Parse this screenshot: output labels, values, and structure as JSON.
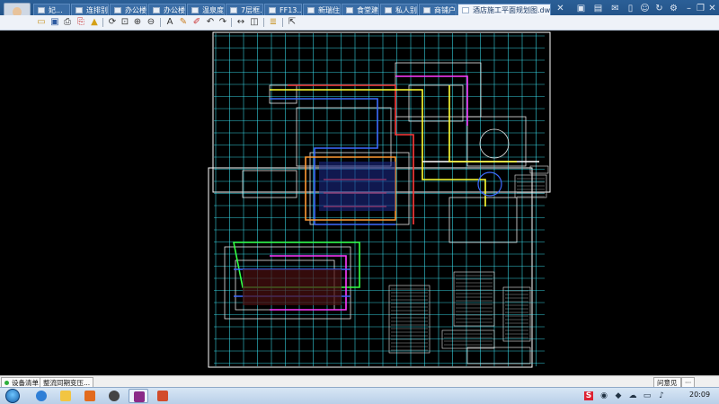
{
  "tabs": [
    {
      "label": "妃...",
      "active": false
    },
    {
      "label": "连排别...",
      "active": false
    },
    {
      "label": "办公楼...",
      "active": false
    },
    {
      "label": "办公楼...",
      "active": false
    },
    {
      "label": "温泉度...",
      "active": false
    },
    {
      "label": "7层框...",
      "active": false
    },
    {
      "label": "FF13...",
      "active": false
    },
    {
      "label": "新瑞住...",
      "active": false
    },
    {
      "label": "食堂建...",
      "active": false
    },
    {
      "label": "私人别...",
      "active": false
    },
    {
      "label": "商铺户...",
      "active": false
    },
    {
      "label": "酒店施工平面规划图.dwg",
      "active": true
    }
  ],
  "toolbar_icons": [
    "open-icon",
    "save-icon",
    "print-icon",
    "print-preview-icon",
    "lock-icon",
    "rotate-icon",
    "zoom-window-icon",
    "zoom-in-icon",
    "zoom-out-icon",
    "text-icon",
    "pencil-icon",
    "marker-icon",
    "undo-icon",
    "redo-icon",
    "dimension-icon",
    "measure-icon",
    "layer-icon",
    "export-icon"
  ],
  "window_icons": [
    "window-icon",
    "folder-icon",
    "mail-icon",
    "mobile-icon",
    "user-icon",
    "refresh-icon",
    "settings-icon",
    "minimize-icon",
    "restore-icon",
    "close-icon"
  ],
  "statusbar": {
    "left_tab": "设备清单",
    "second_tab": "整流同期变压...",
    "feedback": "问意见",
    "more": "···"
  },
  "taskbar": {
    "apps": [
      "ie-icon",
      "explorer-icon",
      "media-icon",
      "qq-icon",
      "winrar-icon",
      "cad-viewer-icon"
    ],
    "tray_icons": [
      "ime-icon",
      "network-icon",
      "security-icon",
      "cloud-icon",
      "monitor-icon",
      "volume-icon"
    ],
    "ime_label": "S",
    "clock": "20:09"
  },
  "colors": {
    "titlebar": "#1d4a7c",
    "grid": "#3ff0ff",
    "canvas": "#000000"
  }
}
